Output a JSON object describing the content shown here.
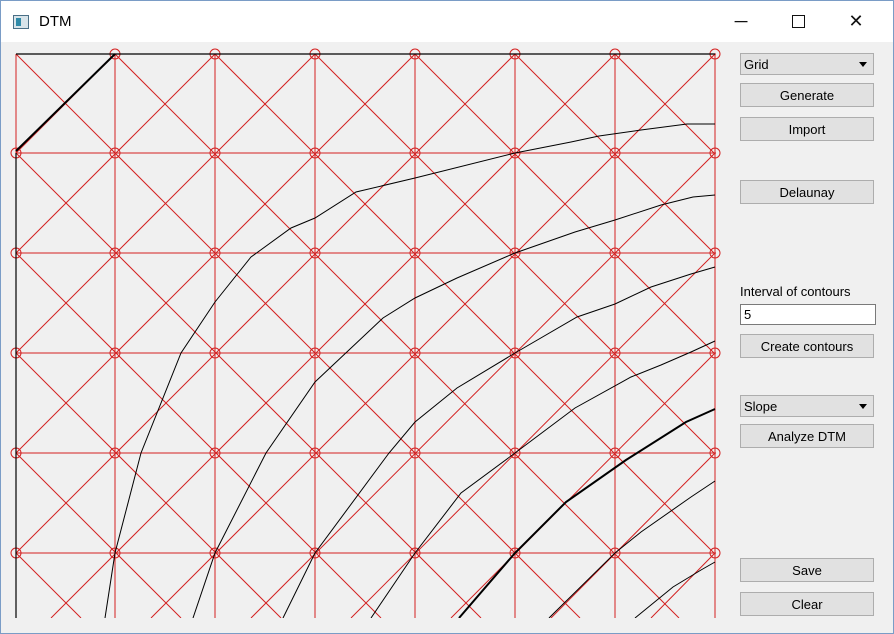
{
  "window": {
    "title": "DTM",
    "minimize_glyph": "─",
    "close_glyph": "✕"
  },
  "panel": {
    "method_select": {
      "value": "Grid"
    },
    "generate_label": "Generate",
    "import_label": "Import",
    "delaunay_label": "Delaunay",
    "interval_label": "Interval of contours",
    "interval_value": "5",
    "create_contours_label": "Create contours",
    "analysis_select": {
      "value": "Slope"
    },
    "analyze_label": "Analyze DTM",
    "save_label": "Save",
    "clear_label": "Clear"
  },
  "colors": {
    "grid": "#d42020",
    "contour": "#000000",
    "background": "#f0f0f0"
  },
  "icons": [
    "app-icon",
    "minimize-icon",
    "maximize-icon",
    "close-icon",
    "chevron-down-icon"
  ]
}
